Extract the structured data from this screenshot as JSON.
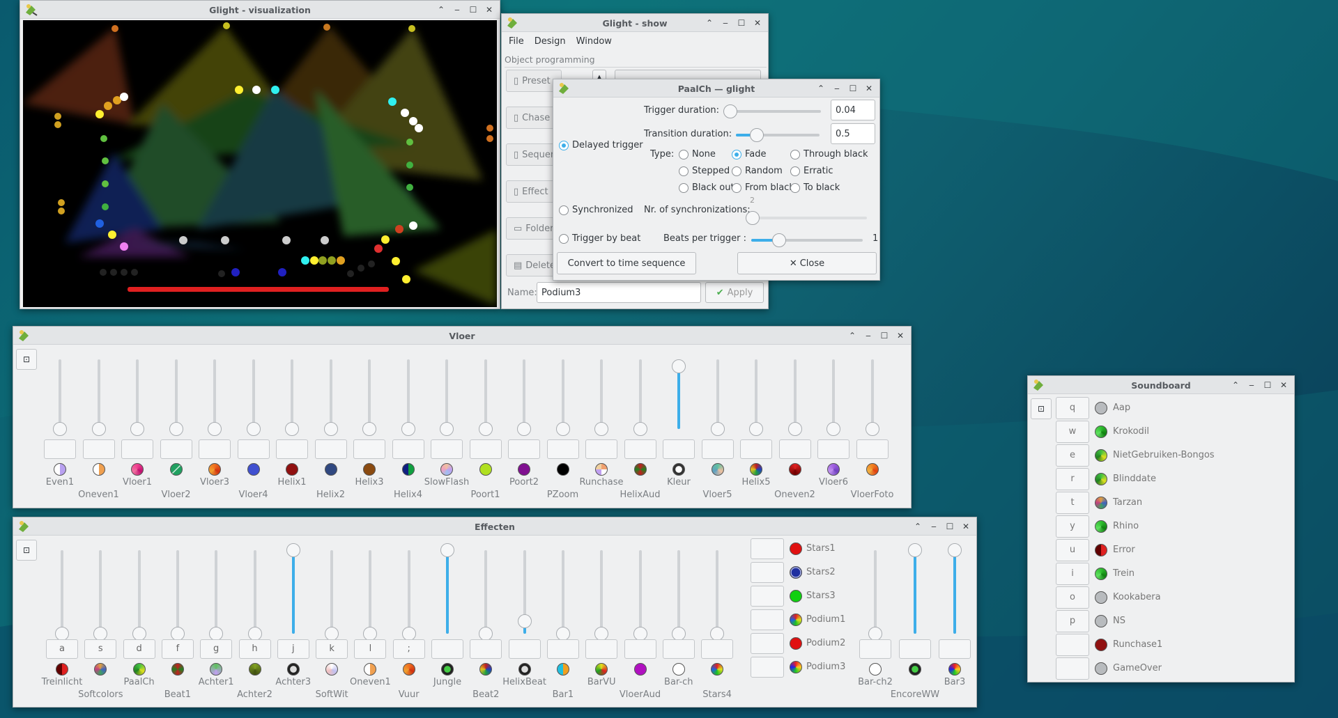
{
  "colors": {
    "accent": "#3daee9",
    "titlebar": "#e3e5e7"
  },
  "visualization": {
    "title": "Glight - visualization"
  },
  "show": {
    "title": "Glight - show",
    "menu": [
      "File",
      "Design",
      "Window"
    ],
    "section": "Object programming",
    "side": [
      "Preset",
      "Chase",
      "Sequence",
      "Effect",
      "Folder",
      "Delete"
    ],
    "name_label": "Name:",
    "name_value": "Podium3",
    "apply": "Apply"
  },
  "paalch": {
    "title": "PaalCh — glight",
    "delayed_trigger": "Delayed trigger",
    "trigger_duration_label": "Trigger duration:",
    "trigger_duration": "0.04",
    "trigger_duration_frac": 0.0,
    "transition_duration_label": "Transition duration:",
    "transition_duration": "0.5",
    "transition_duration_frac": 0.25,
    "type_label": "Type:",
    "types": [
      {
        "label": "None",
        "on": false
      },
      {
        "label": "Fade",
        "on": true
      },
      {
        "label": "Through black",
        "on": false
      },
      {
        "label": "Stepped",
        "on": false
      },
      {
        "label": "Random",
        "on": false
      },
      {
        "label": "Erratic",
        "on": false
      },
      {
        "label": "Black out",
        "on": false
      },
      {
        "label": "From black",
        "on": false
      },
      {
        "label": "To black",
        "on": false
      }
    ],
    "synchronized": "Synchronized",
    "nr_sync_label": "Nr. of synchronizations:",
    "nr_sync_value": "2",
    "trigger_by_beat": "Trigger by beat",
    "beats_label": "Beats per trigger :",
    "beats_value": "1",
    "beats_frac": 0.25,
    "convert": "Convert to time sequence",
    "close": "Close"
  },
  "vloer": {
    "title": "Vloer",
    "faders": [
      {
        "label": "Even1",
        "level": 0,
        "icon": "icon-lavender-white",
        "key": ""
      },
      {
        "label": "Oneven1",
        "level": 0,
        "icon": "icon-orange-white",
        "key": ""
      },
      {
        "label": "Vloer1",
        "level": 0,
        "icon": "icon-pink-magenta",
        "key": ""
      },
      {
        "label": "Vloer2",
        "level": 0,
        "icon": "icon-green-stripe",
        "key": ""
      },
      {
        "label": "Vloer3",
        "level": 0,
        "icon": "icon-orange-red",
        "key": ""
      },
      {
        "label": "Vloer4",
        "level": 0,
        "icon": "icon-blue",
        "key": ""
      },
      {
        "label": "Helix1",
        "level": 0,
        "icon": "icon-darkred",
        "key": ""
      },
      {
        "label": "Helix2",
        "level": 0,
        "icon": "icon-navy",
        "key": ""
      },
      {
        "label": "Helix3",
        "level": 0,
        "icon": "icon-brown",
        "key": ""
      },
      {
        "label": "Helix4",
        "level": 0,
        "icon": "icon-blue-green",
        "key": ""
      },
      {
        "label": "SlowFlash",
        "level": 0,
        "icon": "icon-multi-pastel",
        "key": ""
      },
      {
        "label": "Poort1",
        "level": 0,
        "icon": "icon-yellowgreen",
        "key": ""
      },
      {
        "label": "Poort2",
        "level": 0,
        "icon": "icon-purple",
        "key": ""
      },
      {
        "label": "PZoom",
        "level": 0,
        "icon": "icon-black",
        "key": ""
      },
      {
        "label": "Runchase",
        "level": 0,
        "icon": "icon-pastel-quarters",
        "key": ""
      },
      {
        "label": "HelixAud",
        "level": 0,
        "icon": "icon-red-green",
        "key": ""
      },
      {
        "label": "Kleur",
        "level": 0.9,
        "icon": "icon-crossed",
        "key": ""
      },
      {
        "label": "Vloer5",
        "level": 0,
        "icon": "icon-teal-pastel",
        "key": ""
      },
      {
        "label": "Helix5",
        "level": 0,
        "icon": "icon-multi-dark",
        "key": ""
      },
      {
        "label": "Oneven2",
        "level": 0,
        "icon": "icon-red-dark",
        "key": ""
      },
      {
        "label": "Vloer6",
        "level": 0,
        "icon": "icon-violet-burst",
        "key": ""
      },
      {
        "label": "VloerFoto",
        "level": 0,
        "icon": "icon-orange-burst",
        "key": ""
      }
    ]
  },
  "effecten": {
    "title": "Effecten",
    "faders": [
      {
        "label": "Treinlicht",
        "level": 0,
        "icon": "icon-red-darkred",
        "key": "a"
      },
      {
        "label": "Softcolors",
        "level": 0,
        "icon": "icon-multi-burst",
        "key": "s"
      },
      {
        "label": "PaalCh",
        "level": 0,
        "icon": "icon-green-yellow",
        "key": "d"
      },
      {
        "label": "Beat1",
        "level": 0,
        "icon": "icon-red-green",
        "key": "f"
      },
      {
        "label": "Achter1",
        "level": 0,
        "icon": "icon-green-pastel",
        "key": "g"
      },
      {
        "label": "Achter2",
        "level": 0,
        "icon": "icon-olive",
        "key": "h"
      },
      {
        "label": "Achter3",
        "level": 1,
        "icon": "icon-crossed-dark",
        "key": "j"
      },
      {
        "label": "SoftWit",
        "level": 0,
        "icon": "icon-white-pastel",
        "key": "k"
      },
      {
        "label": "Oneven1",
        "level": 0,
        "icon": "icon-orange-white",
        "key": "l"
      },
      {
        "label": "Vuur",
        "level": 0,
        "icon": "icon-orange-red",
        "key": ";"
      },
      {
        "label": "Jungle",
        "level": 1,
        "icon": "icon-crossed-green",
        "key": ""
      },
      {
        "label": "Beat2",
        "level": 0,
        "icon": "icon-multi-dark",
        "key": ""
      },
      {
        "label": "HelixBeat",
        "level": 0.15,
        "icon": "icon-crossed-dark",
        "key": ""
      },
      {
        "label": "Bar1",
        "level": 0,
        "icon": "icon-orange-cyan",
        "key": ""
      },
      {
        "label": "BarVU",
        "level": 0,
        "icon": "icon-yellow-red",
        "key": ""
      },
      {
        "label": "VloerAud",
        "level": 0,
        "icon": "icon-magenta",
        "key": ""
      },
      {
        "label": "Bar-ch",
        "level": 0,
        "icon": "icon-white",
        "key": ""
      },
      {
        "label": "Stars4",
        "level": 0,
        "icon": "icon-rainbow",
        "key": ""
      }
    ],
    "buttons": [
      {
        "label": "Stars1",
        "icon": "icon-red"
      },
      {
        "label": "Stars2",
        "icon": "icon-navy-ring"
      },
      {
        "label": "Stars3",
        "icon": "icon-green"
      },
      {
        "label": "Podium1",
        "icon": "icon-rainbow"
      },
      {
        "label": "Podium2",
        "icon": "icon-red"
      },
      {
        "label": "Podium3",
        "icon": "icon-crossed-rainbow"
      }
    ],
    "faders2": [
      {
        "label": "Bar-ch2",
        "level": 0,
        "icon": "icon-white",
        "key": ""
      },
      {
        "label": "EncoreWW",
        "level": 1,
        "icon": "icon-crossed-green",
        "key": ""
      },
      {
        "label": "Bar3",
        "level": 1,
        "icon": "icon-crossed-rainbow",
        "key": ""
      }
    ]
  },
  "soundboard": {
    "title": "Soundboard",
    "items": [
      {
        "key": "q",
        "name": "Aap",
        "icon": "icon-gray"
      },
      {
        "key": "w",
        "name": "Krokodil",
        "icon": "icon-green-burst"
      },
      {
        "key": "e",
        "name": "NietGebruiken-Bongos",
        "icon": "icon-green-yellow"
      },
      {
        "key": "r",
        "name": "Blinddate",
        "icon": "icon-green-yellow"
      },
      {
        "key": "t",
        "name": "Tarzan",
        "icon": "icon-multi-burst"
      },
      {
        "key": "y",
        "name": "Rhino",
        "icon": "icon-green-burst"
      },
      {
        "key": "u",
        "name": "Error",
        "icon": "icon-red-darkred"
      },
      {
        "key": "i",
        "name": "Trein",
        "icon": "icon-green-burst"
      },
      {
        "key": "o",
        "name": "Kookabera",
        "icon": "icon-gray"
      },
      {
        "key": "p",
        "name": "NS",
        "icon": "icon-gray"
      },
      {
        "key": "",
        "name": "Runchase1",
        "icon": "icon-darkred"
      },
      {
        "key": "",
        "name": "GameOver",
        "icon": "icon-gray"
      }
    ]
  }
}
